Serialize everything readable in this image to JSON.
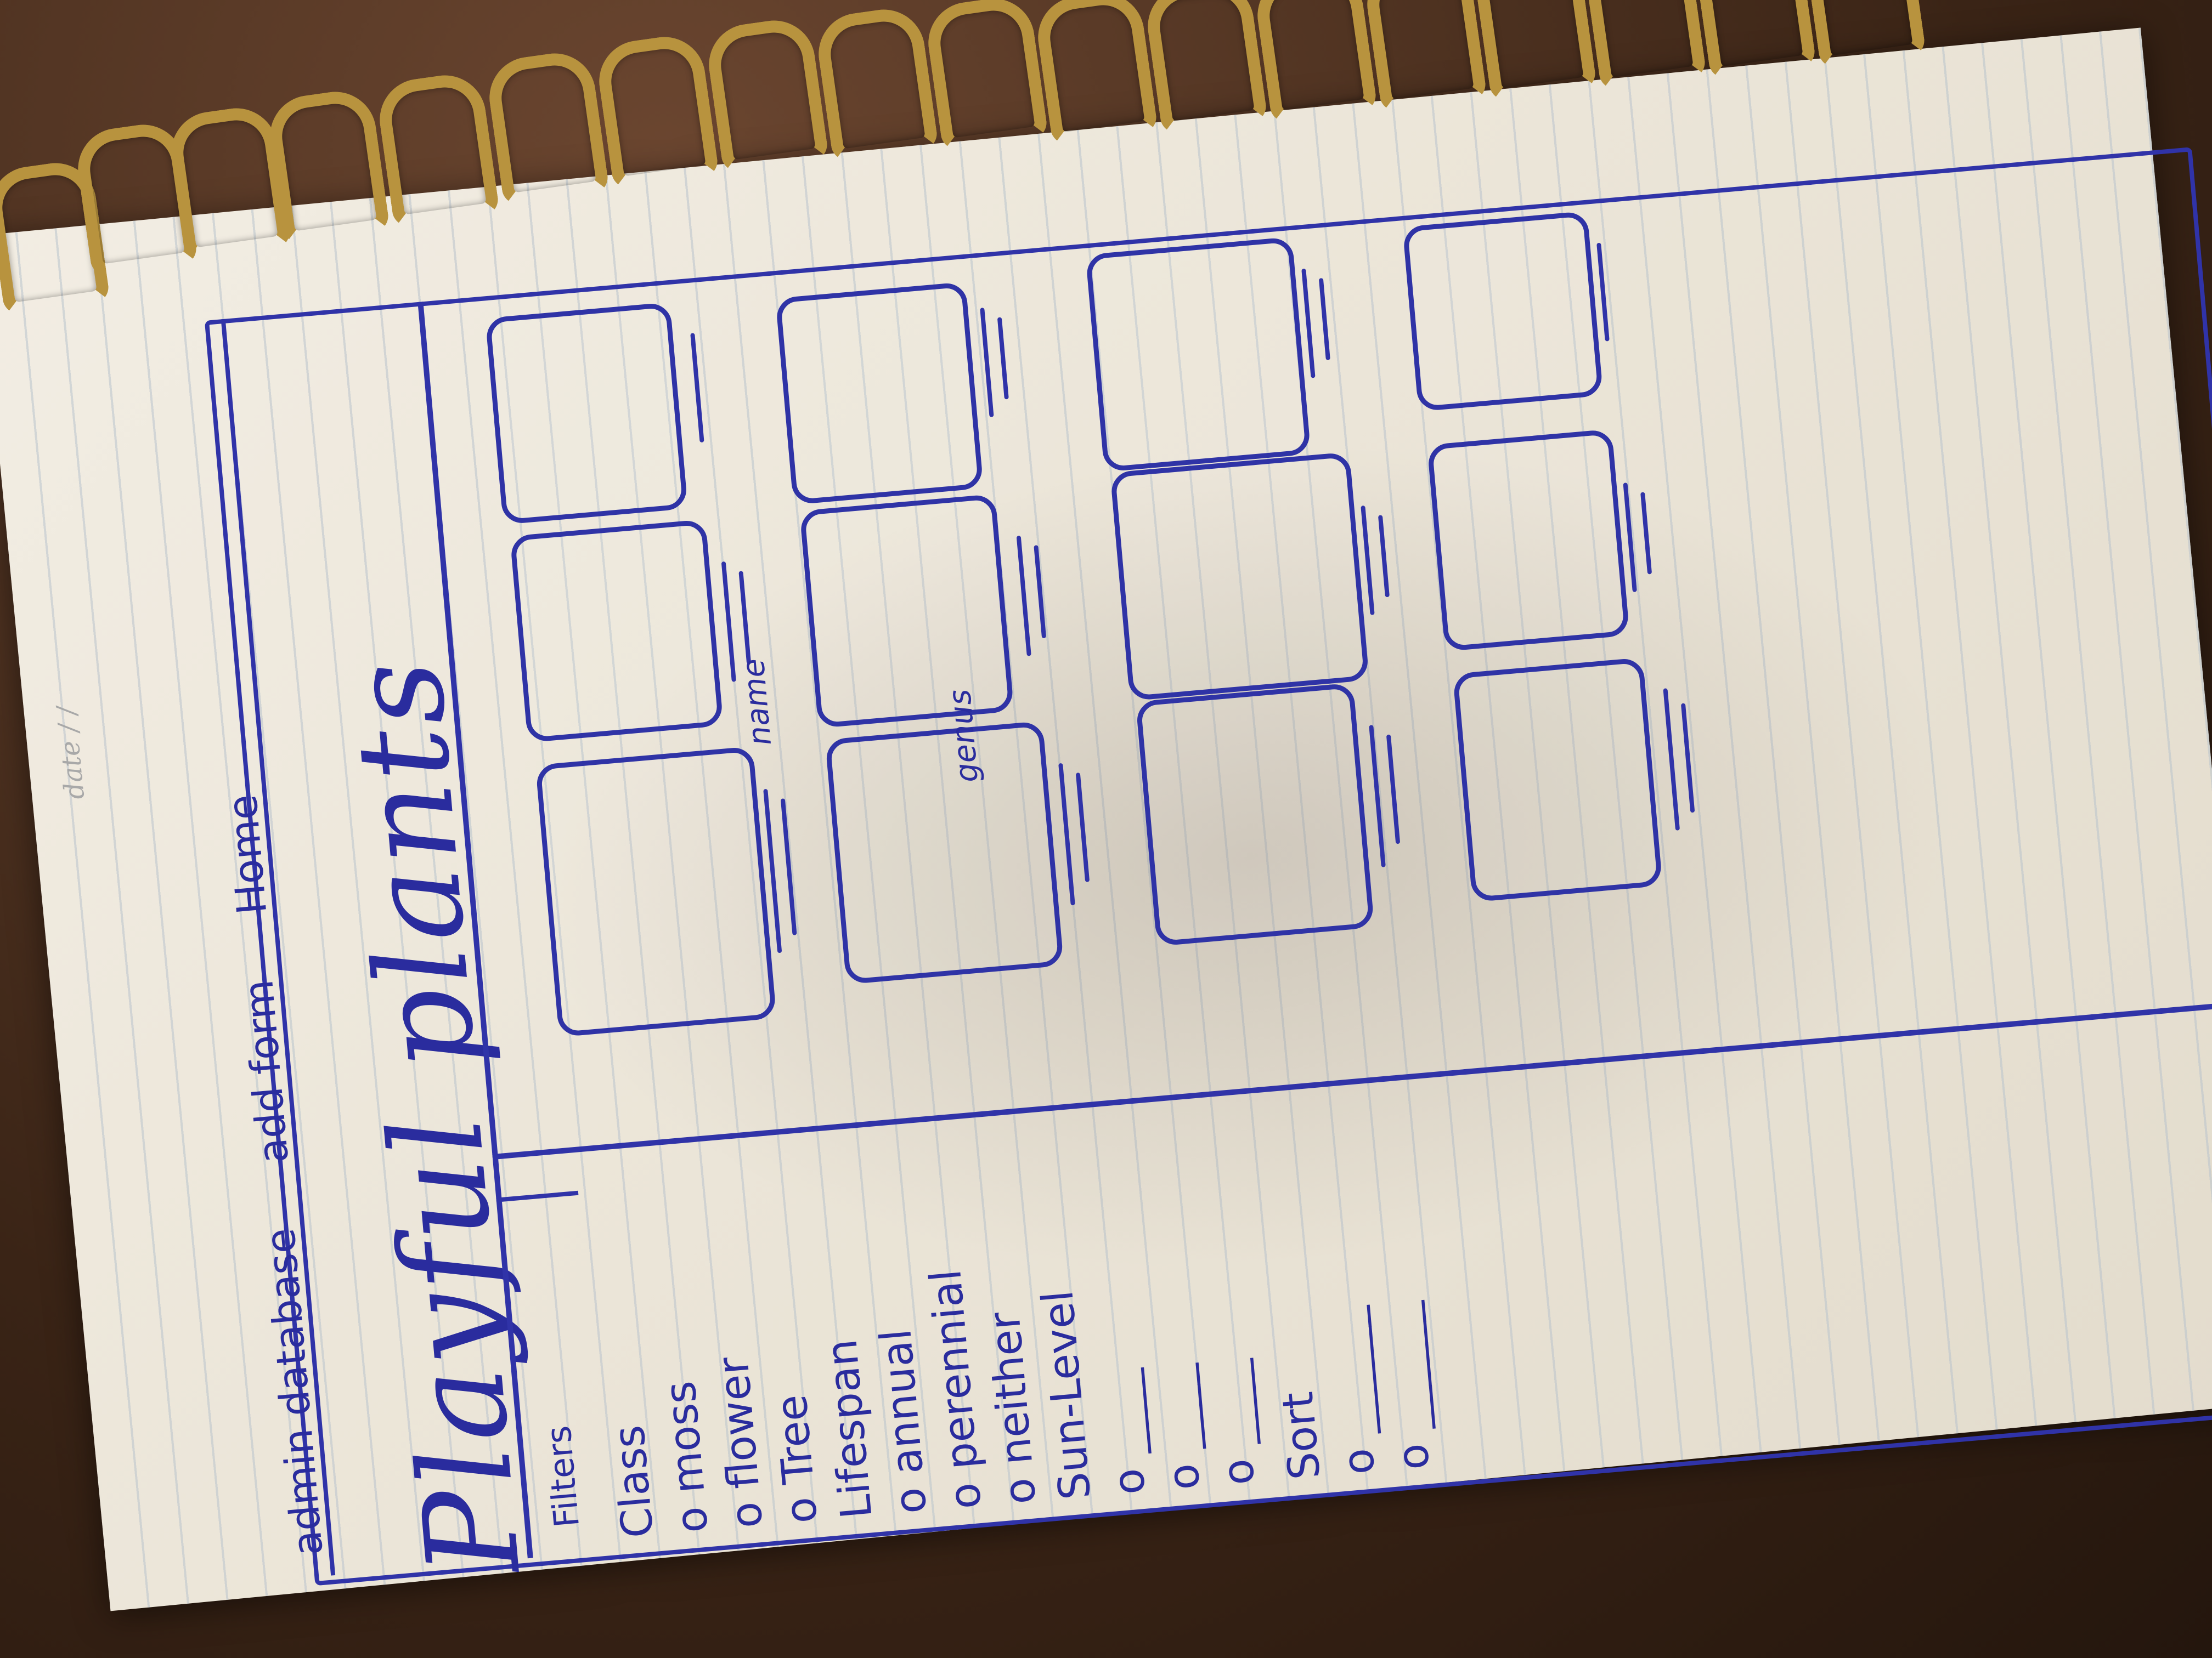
{
  "page": {
    "date_label": "date  /  /"
  },
  "nav": {
    "items": [
      "admin database",
      "add form",
      "Home"
    ]
  },
  "header": {
    "title": "Playful plants"
  },
  "sidebar": {
    "filters_label": "Filters",
    "class_heading": "Class",
    "class_options": [
      "moss",
      "flower",
      "Tree"
    ],
    "lifespan_heading": "Lifespan",
    "lifespan_options": [
      "annual",
      "perennial",
      "neither"
    ],
    "sun_heading": "Sun-Level",
    "sort_heading": "Sort"
  },
  "grid": {
    "annotations": [
      "name",
      "genus"
    ],
    "cards": 12
  },
  "colors": {
    "ink": "#2a2c9e",
    "paper": "#ece6d9",
    "ring": "#b8933e"
  }
}
